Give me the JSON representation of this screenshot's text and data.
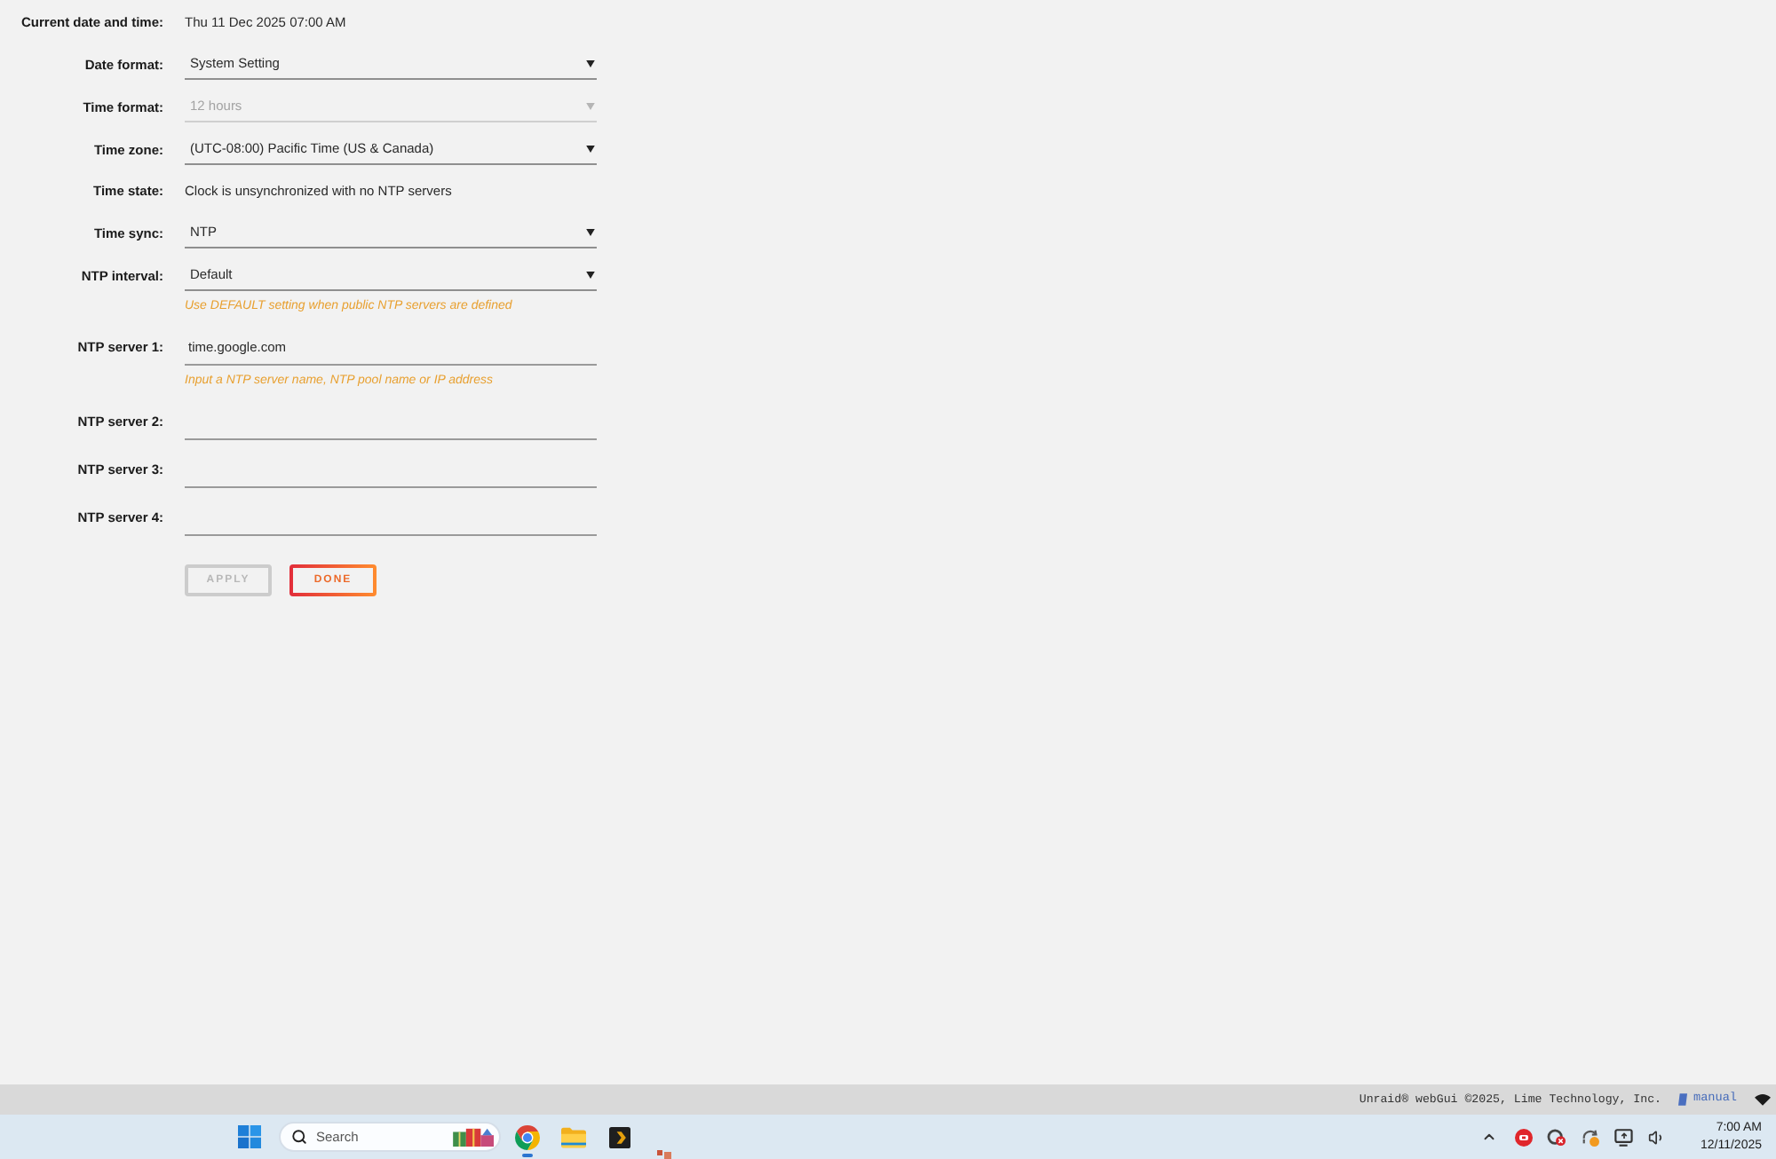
{
  "settings": [
    {
      "kind": "text",
      "label": "Current date and time:",
      "value": "Thu 11 Dec 2025 07:00 AM"
    },
    {
      "kind": "select",
      "label": "Date format:",
      "value": "System Setting",
      "disabled": false
    },
    {
      "kind": "select",
      "label": "Time format:",
      "value": "12 hours",
      "disabled": true
    },
    {
      "kind": "select",
      "label": "Time zone:",
      "value": "(UTC-08:00) Pacific Time (US & Canada)",
      "disabled": false
    },
    {
      "kind": "text",
      "label": "Time state:",
      "value": "Clock is unsynchronized with no NTP servers"
    },
    {
      "kind": "select",
      "label": "Time sync:",
      "value": "NTP",
      "disabled": false
    },
    {
      "kind": "select",
      "label": "NTP interval:",
      "value": "Default",
      "disabled": false,
      "hint": "Use DEFAULT setting when public NTP servers are defined"
    },
    {
      "kind": "input",
      "label": "NTP server 1:",
      "value": "time.google.com",
      "hint": "Input a NTP server name, NTP pool name or IP address"
    },
    {
      "kind": "input",
      "label": "NTP server 2:"
    },
    {
      "kind": "input",
      "label": "NTP server 3:"
    },
    {
      "kind": "input",
      "label": "NTP server 4:"
    }
  ],
  "buttons": [
    {
      "label": "APPLY",
      "disabled": true
    },
    {
      "label": "DONE",
      "disabled": false
    }
  ],
  "footer": {
    "copyright": "Unraid® webGui ©2025, Lime Technology, Inc.",
    "link": "manual"
  },
  "taskbar": {
    "search": {
      "placeholder": "Search"
    },
    "apps": [
      {
        "kind": "browser",
        "running": true
      },
      {
        "kind": "folder",
        "running": false
      },
      {
        "kind": "media",
        "running": false
      }
    ],
    "clock": {
      "time": "7:00 AM",
      "date": "12/11/2025"
    }
  }
}
